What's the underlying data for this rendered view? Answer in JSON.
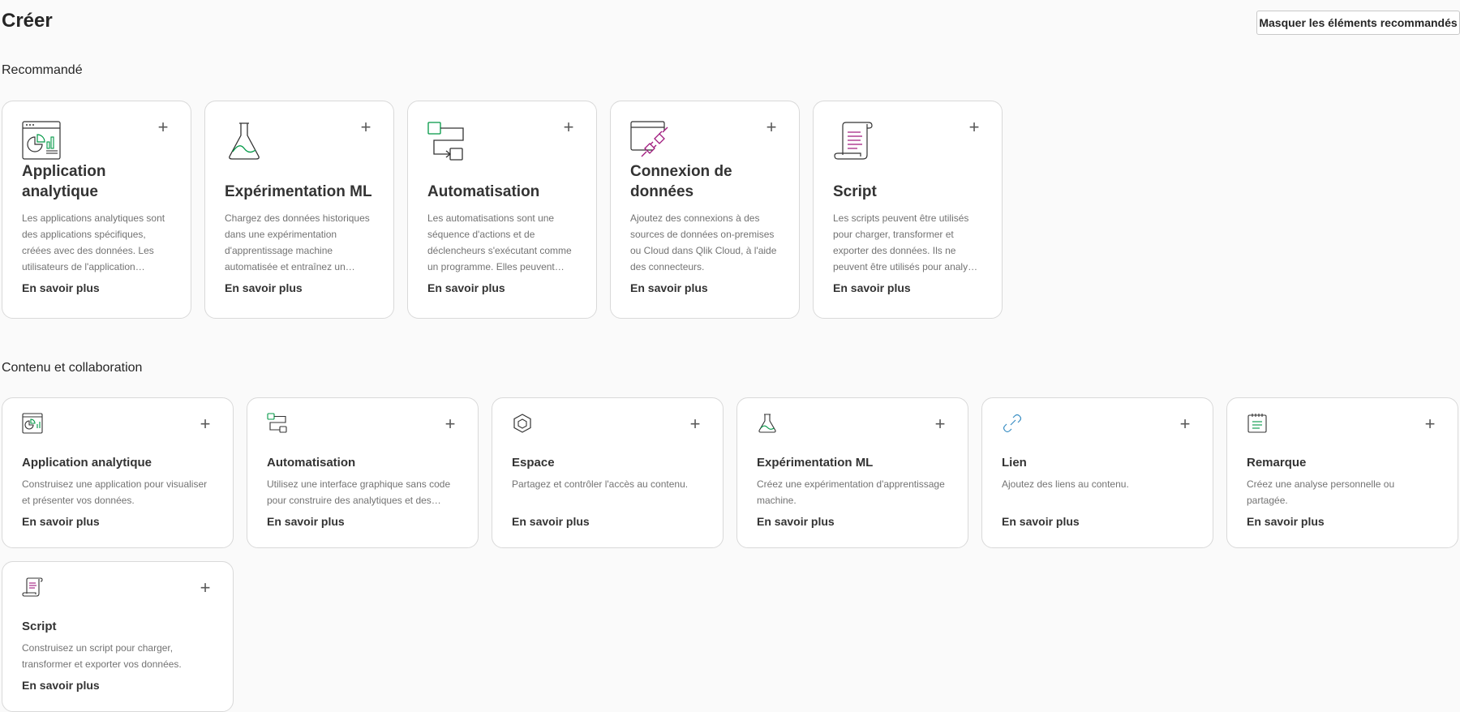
{
  "header": {
    "title": "Créer",
    "hide_button": "Masquer les éléments recommandés"
  },
  "recommended": {
    "section_title": "Recommandé",
    "cards": [
      {
        "icon": "analytics-app-icon",
        "title": "Application analytique",
        "description": "Les applications analytiques sont des applications spécifiques, créées avec des données. Les utilisateurs de l'application explorent les données…",
        "link": "En savoir plus"
      },
      {
        "icon": "ml-flask-icon",
        "title": "Expérimentation ML",
        "description": "Chargez des données historiques dans une expérimentation d'apprentissage machine automatisée et entraînez un modè…",
        "link": "En savoir plus"
      },
      {
        "icon": "automation-icon",
        "title": "Automatisation",
        "description": "Les automatisations sont une séquence d'actions et de déclencheurs s'exécutant comme un programme. Elles peuvent se…",
        "link": "En savoir plus"
      },
      {
        "icon": "data-connection-icon",
        "title": "Connexion de données",
        "description": "Ajoutez des connexions à des sources de données on-premises ou Cloud dans Qlik Cloud, à l'aide des connecteurs.",
        "link": "En savoir plus"
      },
      {
        "icon": "script-scroll-icon",
        "title": "Script",
        "description": "Les scripts peuvent être utilisés pour charger, transformer et exporter des données. Ils ne peuvent être utilisés pour analyser ou visualiser des…",
        "link": "En savoir plus"
      }
    ]
  },
  "content": {
    "section_title": "Contenu et collaboration",
    "cards": [
      {
        "icon": "analytics-app-icon",
        "title": "Application analytique",
        "description": "Construisez une application pour visualiser et présenter vos données.",
        "link": "En savoir plus"
      },
      {
        "icon": "automation-icon",
        "title": "Automatisation",
        "description": "Utilisez une interface graphique sans code pour construire des analytiques et des workflows …",
        "link": "En savoir plus"
      },
      {
        "icon": "space-cube-icon",
        "title": "Espace",
        "description": "Partagez et contrôler l'accès au contenu.",
        "link": "En savoir plus"
      },
      {
        "icon": "ml-flask-icon",
        "title": "Expérimentation ML",
        "description": "Créez une expérimentation d'apprentissage machine.",
        "link": "En savoir plus"
      },
      {
        "icon": "link-icon",
        "title": "Lien",
        "description": "Ajoutez des liens au contenu.",
        "link": "En savoir plus"
      },
      {
        "icon": "note-icon",
        "title": "Remarque",
        "description": "Créez une analyse personnelle ou partagée.",
        "link": "En savoir plus"
      },
      {
        "icon": "script-scroll-icon",
        "title": "Script",
        "description": "Construisez un script pour charger, transformer et exporter vos données.",
        "link": "En savoir plus"
      }
    ]
  },
  "colors": {
    "accent_green": "#009845",
    "accent_purple": "#a0197d",
    "accent_blue": "#3b8fc4"
  }
}
